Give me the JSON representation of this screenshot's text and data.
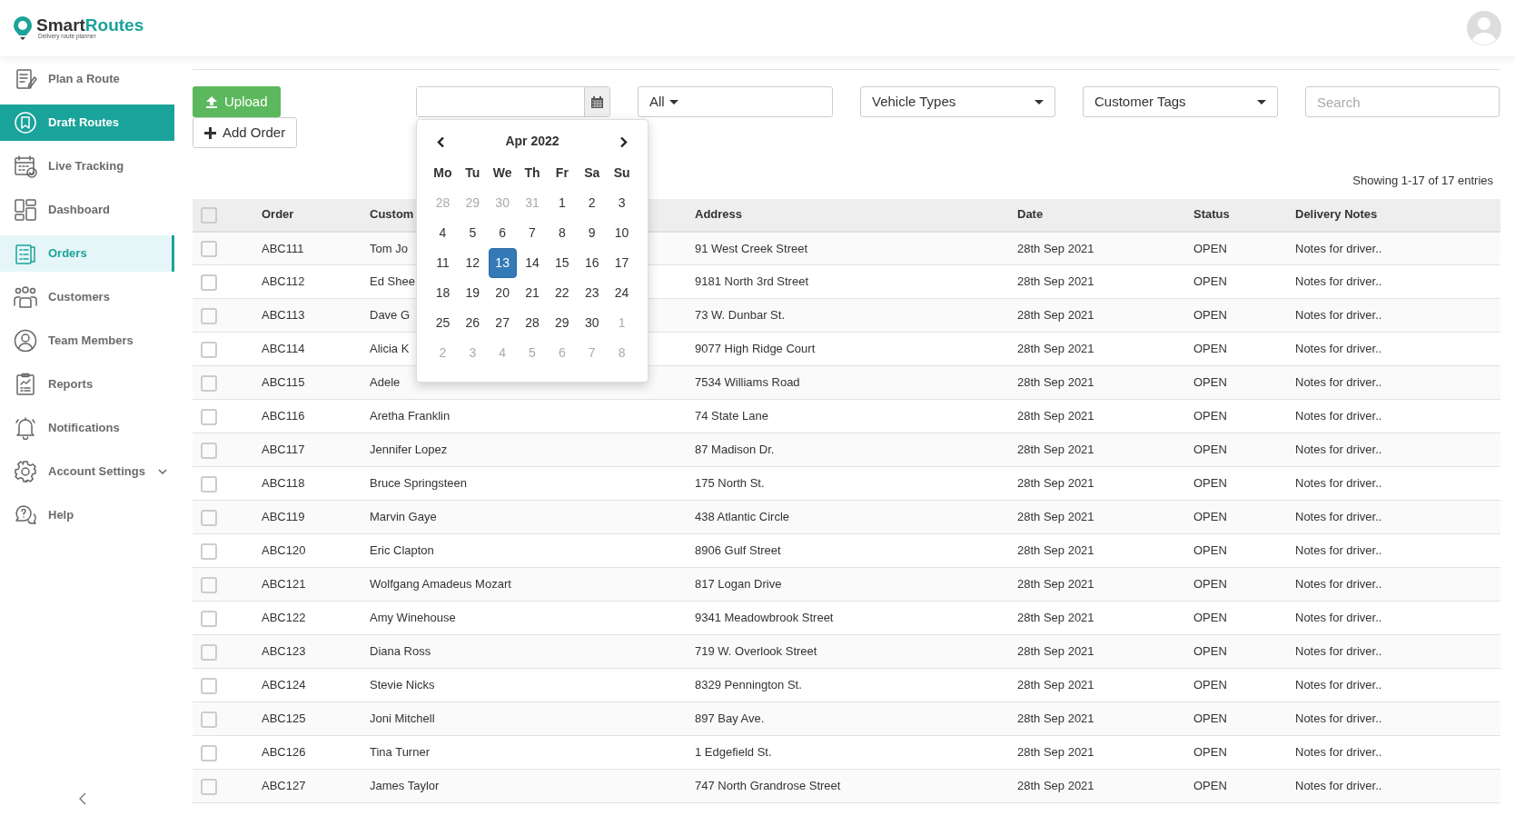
{
  "brand": {
    "name_dark": "Smart",
    "name_accent": "Routes",
    "tagline": "Delivery route planner"
  },
  "sidebar": {
    "items": [
      {
        "label": "Plan a Route",
        "selected": false,
        "hovered": false
      },
      {
        "label": "Draft Routes",
        "selected": false,
        "hovered": true
      },
      {
        "label": "Live Tracking",
        "selected": false,
        "hovered": false
      },
      {
        "label": "Dashboard",
        "selected": false,
        "hovered": false
      },
      {
        "label": "Orders",
        "selected": true,
        "hovered": false
      },
      {
        "label": "Customers",
        "selected": false,
        "hovered": false
      },
      {
        "label": "Team Members",
        "selected": false,
        "hovered": false
      },
      {
        "label": "Reports",
        "selected": false,
        "hovered": false
      },
      {
        "label": "Notifications",
        "selected": false,
        "hovered": false
      },
      {
        "label": "Account Settings",
        "selected": false,
        "hovered": false,
        "expandable": true
      },
      {
        "label": "Help",
        "selected": false,
        "hovered": false
      }
    ]
  },
  "toolbar": {
    "upload": "Upload",
    "add_order": "Add Order",
    "status_filter": "All",
    "vehicle_filter": "Vehicle Types",
    "tags_filter": "Customer Tags",
    "search": {
      "placeholder": "Search"
    }
  },
  "calendar": {
    "title": "Apr 2022",
    "weekdays": [
      "Mo",
      "Tu",
      "We",
      "Th",
      "Fr",
      "Sa",
      "Su"
    ],
    "days": [
      {
        "label": "28",
        "muted": true,
        "selected": false
      },
      {
        "label": "29",
        "muted": true,
        "selected": false
      },
      {
        "label": "30",
        "muted": true,
        "selected": false
      },
      {
        "label": "31",
        "muted": true,
        "selected": false
      },
      {
        "label": "1",
        "muted": false,
        "selected": false
      },
      {
        "label": "2",
        "muted": false,
        "selected": false
      },
      {
        "label": "3",
        "muted": false,
        "selected": false
      },
      {
        "label": "4",
        "muted": false,
        "selected": false
      },
      {
        "label": "5",
        "muted": false,
        "selected": false
      },
      {
        "label": "6",
        "muted": false,
        "selected": false
      },
      {
        "label": "7",
        "muted": false,
        "selected": false
      },
      {
        "label": "8",
        "muted": false,
        "selected": false
      },
      {
        "label": "9",
        "muted": false,
        "selected": false
      },
      {
        "label": "10",
        "muted": false,
        "selected": false
      },
      {
        "label": "11",
        "muted": false,
        "selected": false
      },
      {
        "label": "12",
        "muted": false,
        "selected": false
      },
      {
        "label": "13",
        "muted": false,
        "selected": true
      },
      {
        "label": "14",
        "muted": false,
        "selected": false
      },
      {
        "label": "15",
        "muted": false,
        "selected": false
      },
      {
        "label": "16",
        "muted": false,
        "selected": false
      },
      {
        "label": "17",
        "muted": false,
        "selected": false
      },
      {
        "label": "18",
        "muted": false,
        "selected": false
      },
      {
        "label": "19",
        "muted": false,
        "selected": false
      },
      {
        "label": "20",
        "muted": false,
        "selected": false
      },
      {
        "label": "21",
        "muted": false,
        "selected": false
      },
      {
        "label": "22",
        "muted": false,
        "selected": false
      },
      {
        "label": "23",
        "muted": false,
        "selected": false
      },
      {
        "label": "24",
        "muted": false,
        "selected": false
      },
      {
        "label": "25",
        "muted": false,
        "selected": false
      },
      {
        "label": "26",
        "muted": false,
        "selected": false
      },
      {
        "label": "27",
        "muted": false,
        "selected": false
      },
      {
        "label": "28",
        "muted": false,
        "selected": false
      },
      {
        "label": "29",
        "muted": false,
        "selected": false
      },
      {
        "label": "30",
        "muted": false,
        "selected": false
      },
      {
        "label": "1",
        "muted": true,
        "selected": false
      },
      {
        "label": "2",
        "muted": true,
        "selected": false
      },
      {
        "label": "3",
        "muted": true,
        "selected": false
      },
      {
        "label": "4",
        "muted": true,
        "selected": false
      },
      {
        "label": "5",
        "muted": true,
        "selected": false
      },
      {
        "label": "6",
        "muted": true,
        "selected": false
      },
      {
        "label": "7",
        "muted": true,
        "selected": false
      },
      {
        "label": "8",
        "muted": true,
        "selected": false
      }
    ]
  },
  "table": {
    "summary": "Showing 1-17 of 17 entries",
    "all_checked": false,
    "columns": [
      "Order",
      "Custom",
      "Address",
      "Date",
      "Status",
      "Delivery Notes"
    ],
    "rows": [
      {
        "checked": false,
        "cells": [
          "ABC111",
          "Tom Jo",
          "91 West Creek Street",
          "28th Sep 2021",
          "OPEN",
          "Notes for driver.."
        ]
      },
      {
        "checked": false,
        "cells": [
          "ABC112",
          "Ed Shee",
          "9181 North 3rd Street",
          "28th Sep 2021",
          "OPEN",
          "Notes for driver.."
        ]
      },
      {
        "checked": false,
        "cells": [
          "ABC113",
          "Dave G",
          "73 W. Dunbar St.",
          "28th Sep 2021",
          "OPEN",
          "Notes for driver.."
        ]
      },
      {
        "checked": false,
        "cells": [
          "ABC114",
          "Alicia K",
          "9077 High Ridge Court",
          "28th Sep 2021",
          "OPEN",
          "Notes for driver.."
        ]
      },
      {
        "checked": false,
        "cells": [
          "ABC115",
          "Adele",
          "7534 Williams Road",
          "28th Sep 2021",
          "OPEN",
          "Notes for driver.."
        ]
      },
      {
        "checked": false,
        "cells": [
          "ABC116",
          "Aretha Franklin",
          "74 State Lane",
          "28th Sep 2021",
          "OPEN",
          "Notes for driver.."
        ]
      },
      {
        "checked": false,
        "cells": [
          "ABC117",
          "Jennifer Lopez",
          "87 Madison Dr.",
          "28th Sep 2021",
          "OPEN",
          "Notes for driver.."
        ]
      },
      {
        "checked": false,
        "cells": [
          "ABC118",
          "Bruce Springsteen",
          "175 North St.",
          "28th Sep 2021",
          "OPEN",
          "Notes for driver.."
        ]
      },
      {
        "checked": false,
        "cells": [
          "ABC119",
          "Marvin Gaye",
          "438 Atlantic Circle",
          "28th Sep 2021",
          "OPEN",
          "Notes for driver.."
        ]
      },
      {
        "checked": false,
        "cells": [
          "ABC120",
          "Eric Clapton",
          "8906 Gulf Street",
          "28th Sep 2021",
          "OPEN",
          "Notes for driver.."
        ]
      },
      {
        "checked": false,
        "cells": [
          "ABC121",
          "Wolfgang Amadeus Mozart",
          "817 Logan Drive",
          "28th Sep 2021",
          "OPEN",
          "Notes for driver.."
        ]
      },
      {
        "checked": false,
        "cells": [
          "ABC122",
          "Amy Winehouse",
          "9341 Meadowbrook Street",
          "28th Sep 2021",
          "OPEN",
          "Notes for driver.."
        ]
      },
      {
        "checked": false,
        "cells": [
          "ABC123",
          "Diana Ross",
          "719 W. Overlook Street",
          "28th Sep 2021",
          "OPEN",
          "Notes for driver.."
        ]
      },
      {
        "checked": false,
        "cells": [
          "ABC124",
          "Stevie Nicks",
          "8329 Pennington St.",
          "28th Sep 2021",
          "OPEN",
          "Notes for driver.."
        ]
      },
      {
        "checked": false,
        "cells": [
          "ABC125",
          "Joni Mitchell",
          "897 Bay Ave.",
          "28th Sep 2021",
          "OPEN",
          "Notes for driver.."
        ]
      },
      {
        "checked": false,
        "cells": [
          "ABC126",
          "Tina Turner",
          "1 Edgefield St.",
          "28th Sep 2021",
          "OPEN",
          "Notes for driver.."
        ]
      },
      {
        "checked": false,
        "cells": [
          "ABC127",
          "James Taylor",
          "747 North Grandrose Street",
          "28th Sep 2021",
          "OPEN",
          "Notes for driver.."
        ]
      }
    ]
  }
}
